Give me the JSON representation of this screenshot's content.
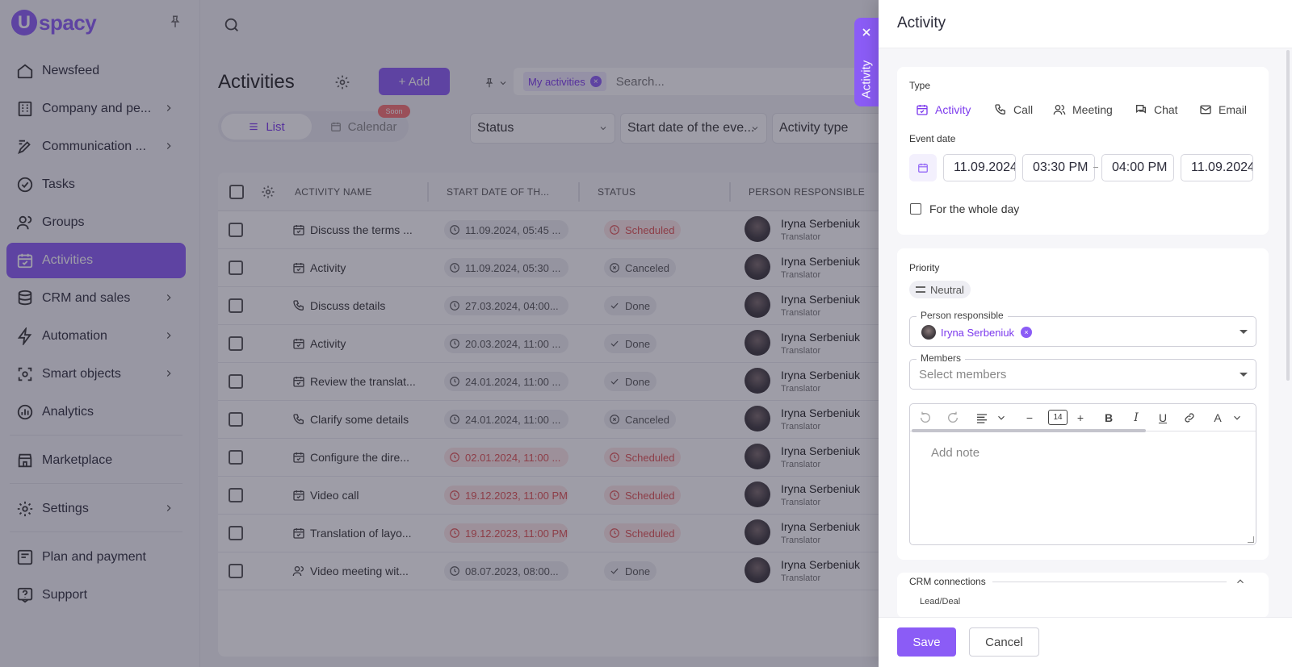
{
  "app": {
    "logo_letter": "U",
    "logo_text": "spacy",
    "brand_color": "#8b5cf6"
  },
  "sidebar": {
    "items": [
      {
        "label": "Newsfeed",
        "icon": "home-icon"
      },
      {
        "label": "Company and pe...",
        "icon": "company-icon"
      },
      {
        "label": "Communication ...",
        "icon": "communication-icon"
      },
      {
        "label": "Tasks",
        "icon": "check-circle-icon"
      },
      {
        "label": "Groups",
        "icon": "users-icon"
      },
      {
        "label": "Activities",
        "icon": "calendar-check-icon"
      },
      {
        "label": "CRM and sales",
        "icon": "database-icon"
      },
      {
        "label": "Automation",
        "icon": "lightning-icon"
      },
      {
        "label": "Smart objects",
        "icon": "smart-object-icon"
      },
      {
        "label": "Analytics",
        "icon": "analytics-icon"
      },
      {
        "label": "Marketplace",
        "icon": "store-icon"
      },
      {
        "label": "Settings",
        "icon": "gear-icon"
      },
      {
        "label": "Plan and payment",
        "icon": "card-icon"
      },
      {
        "label": "Support",
        "icon": "help-icon"
      }
    ]
  },
  "page": {
    "title": "Activities",
    "add_label": "+ Add",
    "my_activities_chip": "My activities",
    "search_placeholder": "Search...",
    "view_list": "List",
    "view_calendar": "Calendar",
    "soon_badge": "Soon",
    "filters": [
      "Status",
      "Start date of the eve...",
      "Activity type"
    ]
  },
  "table": {
    "headers": [
      "ACTIVITY NAME",
      "START DATE OF TH...",
      "STATUS",
      "PERSON RESPONSIBLE"
    ],
    "rows": [
      {
        "name": "Discuss the terms ...",
        "type": "activity",
        "date": "11.09.2024, 05:45 ...",
        "overdue": false,
        "status": "Scheduled",
        "person": "Iryna Serbeniuk",
        "role": "Translator"
      },
      {
        "name": "Activity",
        "type": "activity",
        "date": "11.09.2024, 05:30 ...",
        "overdue": false,
        "status": "Canceled",
        "person": "Iryna Serbeniuk",
        "role": "Translator"
      },
      {
        "name": "Discuss details",
        "type": "call",
        "date": "27.03.2024, 04:00...",
        "overdue": false,
        "status": "Done",
        "person": "Iryna Serbeniuk",
        "role": "Translator"
      },
      {
        "name": "Activity",
        "type": "activity",
        "date": "20.03.2024, 11:00 ...",
        "overdue": false,
        "status": "Done",
        "person": "Iryna Serbeniuk",
        "role": "Translator"
      },
      {
        "name": "Review the translat...",
        "type": "activity",
        "date": "24.01.2024, 11:00 ...",
        "overdue": false,
        "status": "Done",
        "person": "Iryna Serbeniuk",
        "role": "Translator"
      },
      {
        "name": "Clarify some details",
        "type": "call",
        "date": "24.01.2024, 11:00 ...",
        "overdue": false,
        "status": "Canceled",
        "person": "Iryna Serbeniuk",
        "role": "Translator"
      },
      {
        "name": "Configure the dire...",
        "type": "activity",
        "date": "02.01.2024, 11:00 ...",
        "overdue": true,
        "status": "Scheduled",
        "person": "Iryna Serbeniuk",
        "role": "Translator"
      },
      {
        "name": "Video call",
        "type": "activity",
        "date": "19.12.2023, 11:00 PM",
        "overdue": true,
        "status": "Scheduled",
        "person": "Iryna Serbeniuk",
        "role": "Translator"
      },
      {
        "name": "Translation of layo...",
        "type": "activity",
        "date": "19.12.2023, 11:00 PM",
        "overdue": true,
        "status": "Scheduled",
        "person": "Iryna Serbeniuk",
        "role": "Translator"
      },
      {
        "name": "Video meeting wit...",
        "type": "meeting",
        "date": "08.07.2023, 08:00...",
        "overdue": false,
        "status": "Done",
        "person": "Iryna Serbeniuk",
        "role": "Translator"
      }
    ]
  },
  "drawer": {
    "title": "Activity",
    "side_tab_label": "Activity",
    "type_label": "Type",
    "types": [
      "Activity",
      "Call",
      "Meeting",
      "Chat",
      "Email"
    ],
    "selected_type": "Activity",
    "event_date_label": "Event date",
    "start_date": "11.09.2024",
    "start_time": "03:30 PM",
    "end_time": "04:00 PM",
    "end_date": "11.09.2024",
    "whole_day_label": "For the whole day",
    "whole_day_checked": false,
    "priority_label": "Priority",
    "priority_value": "Neutral",
    "person_responsible_label": "Person responsible",
    "person_responsible_value": "Iryna Serbeniuk",
    "members_label": "Members",
    "members_placeholder": "Select members",
    "font_size": "14",
    "note_placeholder": "Add note",
    "crm_label": "CRM connections",
    "crm_sub": "Lead/Deal",
    "save_label": "Save",
    "cancel_label": "Cancel"
  }
}
